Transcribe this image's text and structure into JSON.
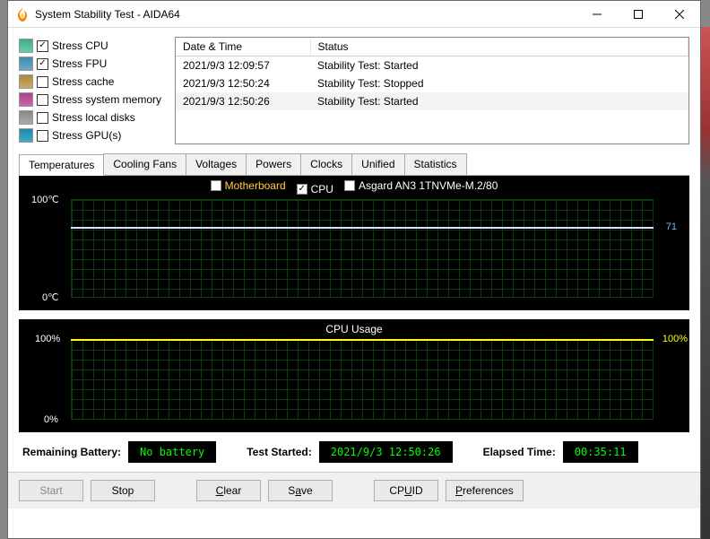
{
  "window": {
    "title": "System Stability Test - AIDA64"
  },
  "stress": [
    {
      "key": "cpu",
      "label": "Stress CPU",
      "checked": true
    },
    {
      "key": "fpu",
      "label": "Stress FPU",
      "checked": true
    },
    {
      "key": "cache",
      "label": "Stress cache",
      "checked": false
    },
    {
      "key": "mem",
      "label": "Stress system memory",
      "checked": false
    },
    {
      "key": "disk",
      "label": "Stress local disks",
      "checked": false
    },
    {
      "key": "gpu",
      "label": "Stress GPU(s)",
      "checked": false
    }
  ],
  "log": {
    "headers": [
      "Date & Time",
      "Status"
    ],
    "rows": [
      {
        "dt": "2021/9/3 12:09:57",
        "st": "Stability Test: Started"
      },
      {
        "dt": "2021/9/3 12:50:24",
        "st": "Stability Test: Stopped"
      },
      {
        "dt": "2021/9/3 12:50:26",
        "st": "Stability Test: Started"
      }
    ]
  },
  "tabs": [
    "Temperatures",
    "Cooling Fans",
    "Voltages",
    "Powers",
    "Clocks",
    "Unified",
    "Statistics"
  ],
  "activeTab": 0,
  "tempChart": {
    "legend": [
      {
        "label": "Motherboard",
        "color": "#ffd040",
        "checked": false
      },
      {
        "label": "CPU",
        "color": "#ffffff",
        "checked": true
      },
      {
        "label": "Asgard AN3 1TNVMe-M.2/80",
        "color": "#ffffff",
        "checked": false
      }
    ],
    "ylabels": {
      "top": "100℃",
      "bottom": "0℃"
    },
    "reading": "71"
  },
  "cpuChart": {
    "title": "CPU Usage",
    "ylabels": {
      "top": "100%",
      "bottom": "0%"
    },
    "reading": "100%"
  },
  "status": {
    "batteryLabel": "Remaining Battery:",
    "batteryValue": "No battery",
    "startedLabel": "Test Started:",
    "startedValue": "2021/9/3 12:50:26",
    "elapsedLabel": "Elapsed Time:",
    "elapsedValue": "00:35:11"
  },
  "buttons": {
    "start": "Start",
    "stop": "Stop",
    "clear": "Clear",
    "save": "Save",
    "cpuid": "CPUID",
    "prefs": "Preferences"
  },
  "chart_data": [
    {
      "type": "line",
      "title": "Temperatures",
      "series": [
        {
          "name": "CPU",
          "values_approx": 71,
          "unit": "°C"
        }
      ],
      "ylim": [
        0,
        100
      ],
      "ylabel": "°C",
      "current_value": 71
    },
    {
      "type": "line",
      "title": "CPU Usage",
      "series": [
        {
          "name": "CPU Usage",
          "values_approx": 100,
          "unit": "%"
        }
      ],
      "ylim": [
        0,
        100
      ],
      "ylabel": "%",
      "current_value": 100
    }
  ]
}
